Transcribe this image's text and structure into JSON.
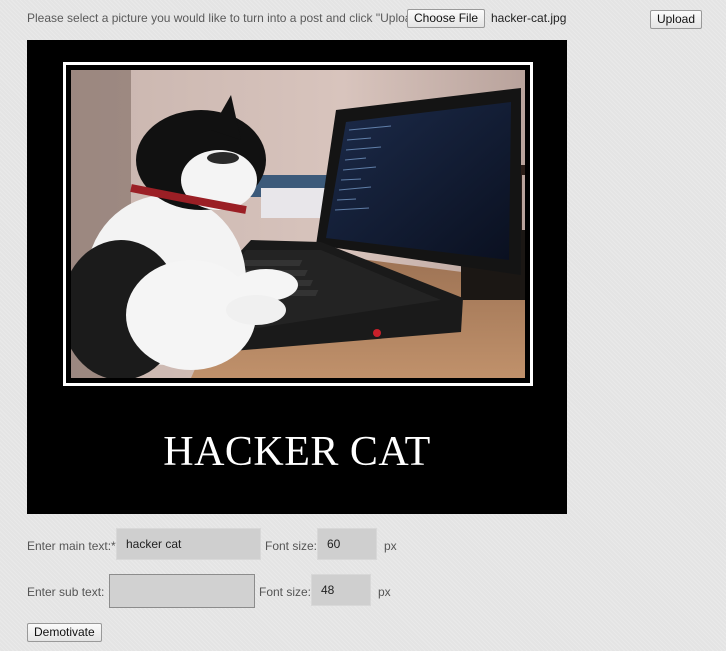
{
  "upload": {
    "instruction": "Please select a picture you would like to turn into a post and click \"Upload\".",
    "choose_file_label": "Choose File",
    "file_name": "hacker-cat.jpg",
    "upload_label": "Upload"
  },
  "poster": {
    "main_text": "HACKER CAT",
    "background": "#000000",
    "frame_color": "#ffffff"
  },
  "form": {
    "main_text_label": "Enter main text:*",
    "main_text_value": "hacker cat",
    "main_font_label": "Font size:",
    "main_font_value": "60",
    "main_font_unit": "px",
    "sub_text_label": "Enter sub text:",
    "sub_text_value": "",
    "sub_font_label": "Font size:",
    "sub_font_value": "48",
    "sub_font_unit": "px",
    "demotivate_label": "Demotivate"
  }
}
